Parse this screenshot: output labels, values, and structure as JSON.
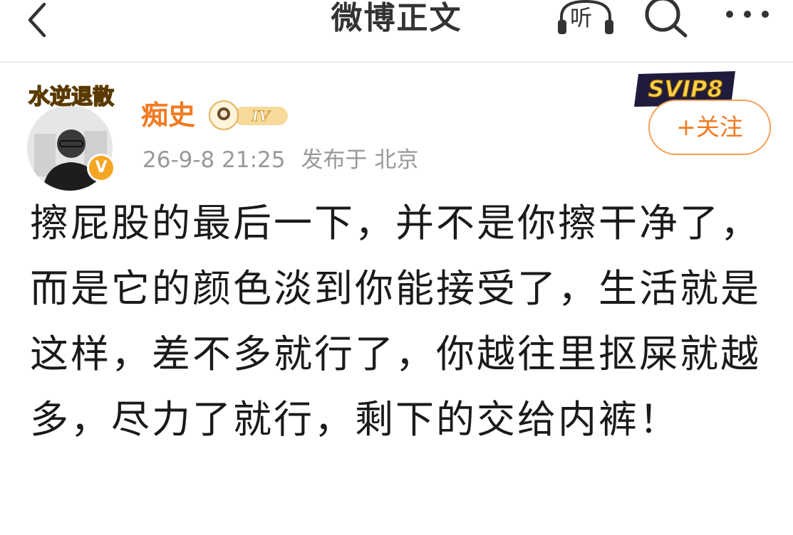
{
  "header": {
    "title": "微博正文",
    "back_icon": "back-chevron-icon",
    "listen_label": "听",
    "search_icon": "search-icon",
    "more_icon": "more-dots-icon"
  },
  "post": {
    "author": {
      "name": "痴史",
      "avatar_banner_text": "水逆退散",
      "verified_badge": "V",
      "level_badge": "IV",
      "svip_label": "SVIP8"
    },
    "timestamp": "26-9-8 21:25",
    "location": "发布于 北京",
    "follow_label": "+关注",
    "text": "擦屁股的最后一下，并不是你擦干净了，而是它的颜色淡到你能接受了，生活就是这样，差不多就行了，你越往里抠屎就越多，尽力了就行，剩下的交给内裤！"
  },
  "colors": {
    "accent_orange": "#f07b22",
    "meta_gray": "#999999",
    "text_dark": "#1a1a1a"
  }
}
